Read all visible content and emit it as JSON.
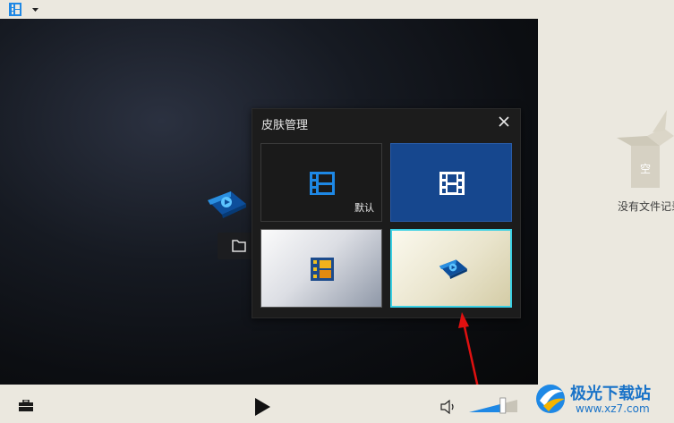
{
  "skin_dialog": {
    "title": "皮肤管理",
    "skins": [
      {
        "label": "默认",
        "selected": false
      },
      {
        "label": "",
        "selected": false
      },
      {
        "label": "",
        "selected": false
      },
      {
        "label": "",
        "selected": true
      }
    ]
  },
  "right_panel": {
    "empty_badge": "空",
    "no_files_text": "没有文件记录"
  },
  "volume": {
    "level": 0.7
  },
  "watermark": {
    "brand": "极光下载站",
    "url": "www.xz7.com"
  },
  "colors": {
    "accent_blue": "#1e88e5",
    "selected_border": "#3ad0e4",
    "arrow": "#e01010"
  }
}
